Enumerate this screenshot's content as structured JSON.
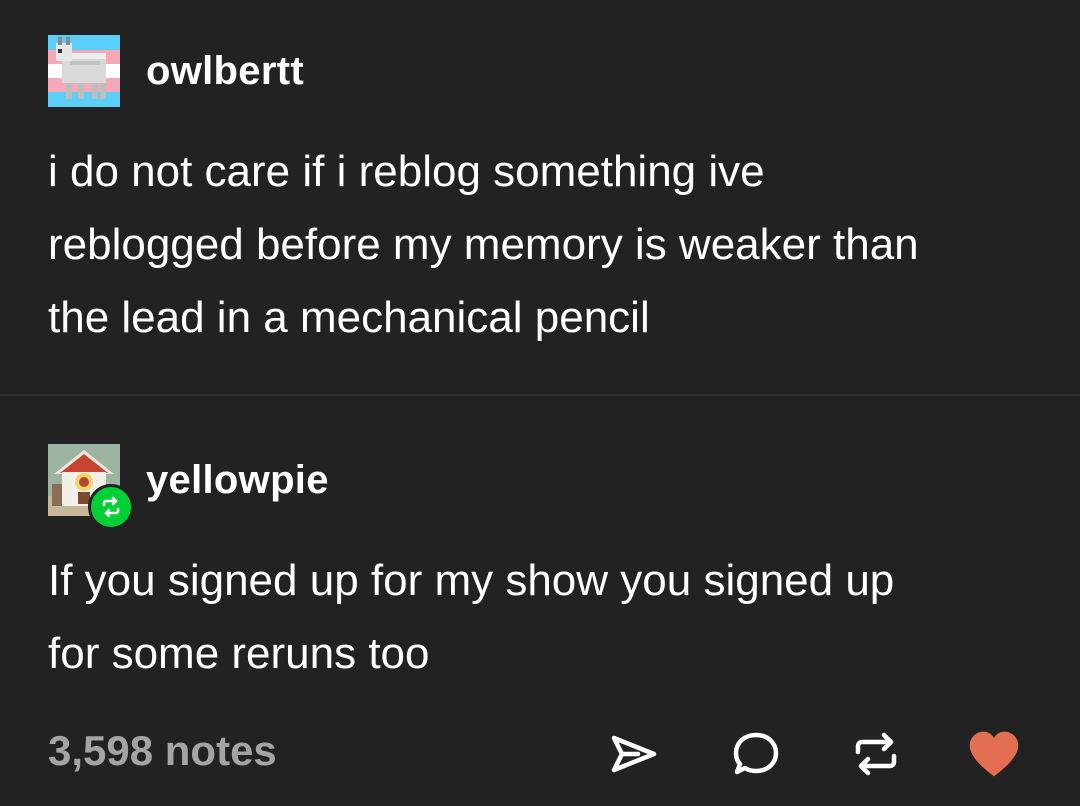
{
  "posts": [
    {
      "username": "owlbertt",
      "avatar_icon": "goat-avatar-icon",
      "body_lines": [
        "i do not care if i reblog something ive",
        "reblogged before my memory is weaker than",
        "the lead in a mechanical pencil"
      ]
    },
    {
      "username": "yellowpie",
      "avatar_icon": "cuckoo-clock-avatar-icon",
      "badge_icon": "reblog-badge-icon",
      "body_lines": [
        "If you signed up for my show you signed up",
        "for some reruns too"
      ]
    }
  ],
  "footer": {
    "notes": "3,598 notes",
    "actions": [
      "share-icon",
      "reply-icon",
      "reblog-icon",
      "like-icon"
    ]
  },
  "colors": {
    "background": "#222222",
    "text": "#ffffff",
    "muted": "#a4a4a4",
    "reblog_green": "#00cf35",
    "like_red": "#e46e51"
  }
}
